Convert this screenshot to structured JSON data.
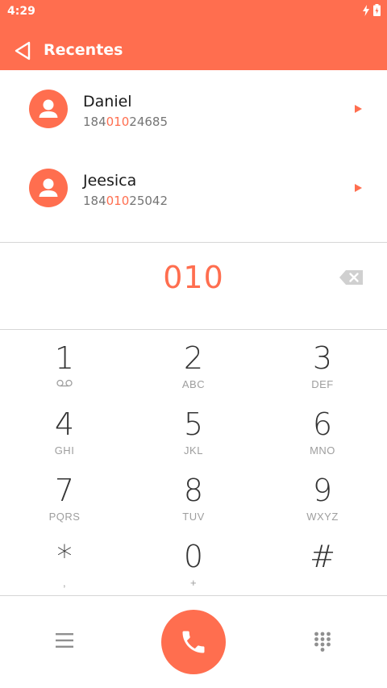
{
  "status_bar": {
    "time": "4:29"
  },
  "header": {
    "title": "Recentes"
  },
  "contacts": [
    {
      "name": "Daniel",
      "number_pre": "184",
      "number_match": "010",
      "number_post": "24685"
    },
    {
      "name": "Jeesica",
      "number_pre": "184",
      "number_match": "010",
      "number_post": "25042"
    }
  ],
  "dialer": {
    "value": "010",
    "keys": [
      {
        "digit": "1",
        "letters": ""
      },
      {
        "digit": "2",
        "letters": "ABC"
      },
      {
        "digit": "3",
        "letters": "DEF"
      },
      {
        "digit": "4",
        "letters": "GHI"
      },
      {
        "digit": "5",
        "letters": "JKL"
      },
      {
        "digit": "6",
        "letters": "MNO"
      },
      {
        "digit": "7",
        "letters": "PQRS"
      },
      {
        "digit": "8",
        "letters": "TUV"
      },
      {
        "digit": "9",
        "letters": "WXYZ"
      },
      {
        "digit": "*",
        "letters": ","
      },
      {
        "digit": "0",
        "letters": "+"
      },
      {
        "digit": "#",
        "letters": ""
      }
    ]
  },
  "colors": {
    "accent": "#FF6E4F",
    "text_primary": "#1a1a1a",
    "text_secondary": "#757575",
    "divider": "#d6d6d6"
  },
  "icons": {
    "back": "back-triangle-icon",
    "voicemail": "voicemail-icon",
    "backspace": "backspace-icon",
    "menu": "menu-icon",
    "call": "phone-icon",
    "dialpad": "dialpad-icon"
  }
}
